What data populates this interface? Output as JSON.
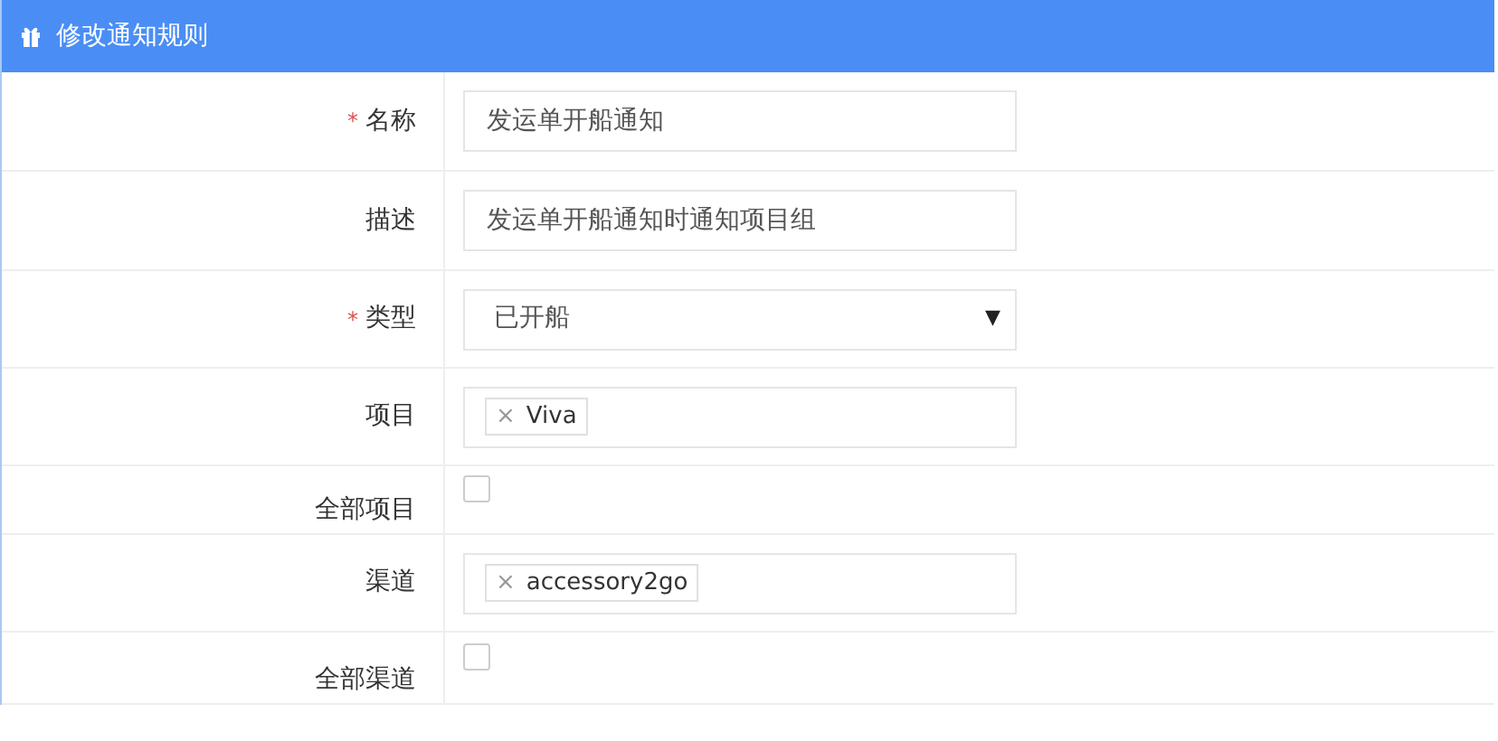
{
  "panel": {
    "title": "修改通知规则"
  },
  "fields": [
    {
      "label": "名称",
      "required_mark": "*",
      "kind": "text",
      "value": "发运单开船通知"
    },
    {
      "label": "描述",
      "kind": "text",
      "value": "发运单开船通知时通知项目组"
    },
    {
      "label": "类型",
      "required_mark": "*",
      "kind": "select",
      "value": "已开船",
      "arrow": "▼"
    },
    {
      "label": "项目",
      "kind": "tags",
      "tags": [
        {
          "remove": "×",
          "text": "Viva"
        }
      ]
    },
    {
      "label": "全部项目",
      "kind": "checkbox",
      "checked": false
    },
    {
      "label": "渠道",
      "kind": "tags",
      "tags": [
        {
          "remove": "×",
          "text": "accessory2go"
        }
      ]
    },
    {
      "label": "全部渠道",
      "kind": "checkbox",
      "checked": false
    }
  ]
}
